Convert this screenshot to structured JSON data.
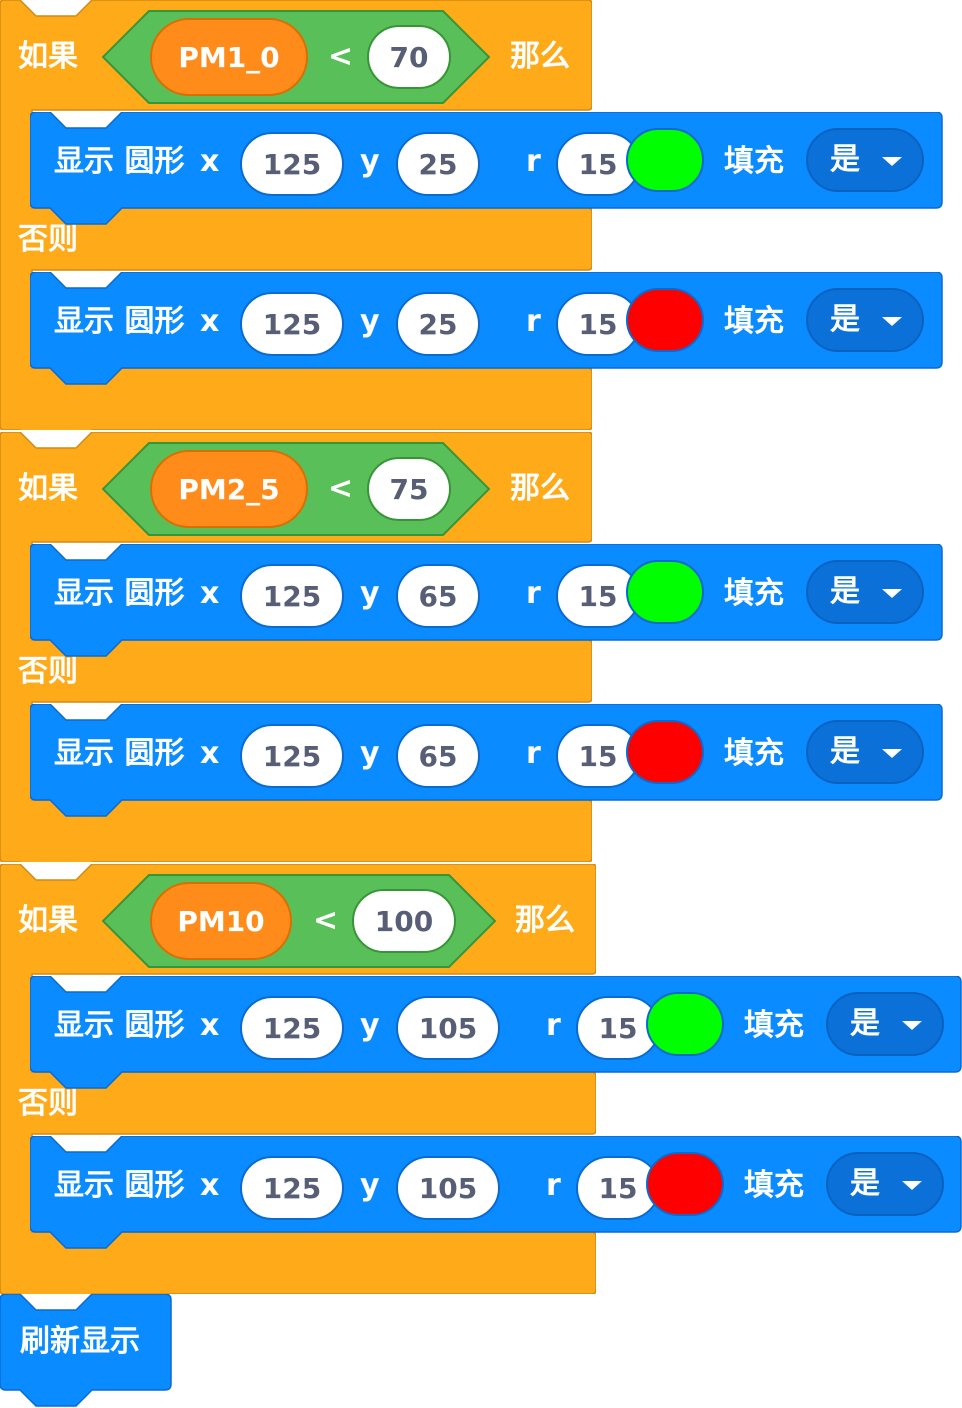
{
  "colors": {
    "control": "#ffab19",
    "control_border": "#cf8b17",
    "operator": "#59c059",
    "operator_border": "#389438",
    "data_reporter": "#ff8c1a",
    "display_block": "#0a8bff",
    "display_border": "#0b6ad0",
    "green_swatch": "#00ff00",
    "red_swatch": "#ff0000"
  },
  "ifelse_blocks": [
    {
      "if_label": "如果",
      "then_label": "那么",
      "else_label": "否则",
      "condition": {
        "variable": "PM1_0",
        "operator": "<",
        "value": "70"
      },
      "then_block": {
        "label": "显示 圆形",
        "x_label": "x",
        "x": "125",
        "y_label": "y",
        "y": "25",
        "r_label": "r",
        "r": "15",
        "color": "green",
        "fill_label": "填充",
        "fill": "是"
      },
      "else_block": {
        "label": "显示 圆形",
        "x_label": "x",
        "x": "125",
        "y_label": "y",
        "y": "25",
        "r_label": "r",
        "r": "15",
        "color": "red",
        "fill_label": "填充",
        "fill": "是"
      }
    },
    {
      "if_label": "如果",
      "then_label": "那么",
      "else_label": "否则",
      "condition": {
        "variable": "PM2_5",
        "operator": "<",
        "value": "75"
      },
      "then_block": {
        "label": "显示 圆形",
        "x_label": "x",
        "x": "125",
        "y_label": "y",
        "y": "65",
        "r_label": "r",
        "r": "15",
        "color": "green",
        "fill_label": "填充",
        "fill": "是"
      },
      "else_block": {
        "label": "显示 圆形",
        "x_label": "x",
        "x": "125",
        "y_label": "y",
        "y": "65",
        "r_label": "r",
        "r": "15",
        "color": "red",
        "fill_label": "填充",
        "fill": "是"
      }
    },
    {
      "if_label": "如果",
      "then_label": "那么",
      "else_label": "否则",
      "condition": {
        "variable": "PM10",
        "operator": "<",
        "value": "100"
      },
      "then_block": {
        "label": "显示 圆形",
        "x_label": "x",
        "x": "125",
        "y_label": "y",
        "y": "105",
        "r_label": "r",
        "r": "15",
        "color": "green",
        "fill_label": "填充",
        "fill": "是"
      },
      "else_block": {
        "label": "显示 圆形",
        "x_label": "x",
        "x": "125",
        "y_label": "y",
        "y": "105",
        "r_label": "r",
        "r": "15",
        "color": "red",
        "fill_label": "填充",
        "fill": "是"
      }
    }
  ],
  "refresh_block": {
    "label": "刷新显示"
  }
}
